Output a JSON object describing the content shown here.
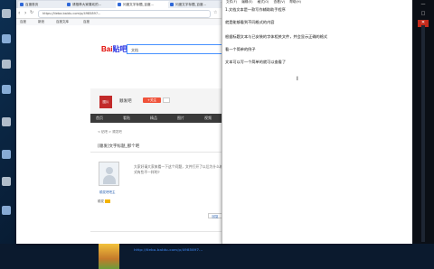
{
  "browser": {
    "tabs": [
      {
        "label": "百度首页",
        "active": false
      },
      {
        "label": "请推荐大家喜欢的...",
        "active": false
      },
      {
        "label": "问度文字标题_百度...",
        "active": true
      },
      {
        "label": "问度文字标题_百度...",
        "active": false
      }
    ],
    "new_tab": "+",
    "url": "https://tieba.baidu.com/p/4985897...",
    "bookmarks": [
      "百度",
      "新浪",
      "百度文库",
      "百度"
    ],
    "logo_text": "Bai",
    "logo_suffix": "贴吧",
    "search_value": "文档",
    "forum_icon_label": "图片",
    "forum_name": "顺发吧",
    "follow_label": "+关注",
    "forum_tabs": [
      "首页",
      "看贴",
      "精品",
      "图片",
      "视频"
    ],
    "breadcrumb": "< 贴吧 > 顺发吧",
    "thread_title": "[顺发]文字标题_那个吧",
    "user_name": "顺发吧吧主",
    "user_level": "顺发",
    "post_text": "大家好请大家来看一下这个问题，文件打开了以后为什么格式有些不一样的?",
    "reply_label": "回复",
    "link_text": "http://tieba.baidu.com/p/4985897..."
  },
  "notepad": {
    "menu": [
      "文件(F)",
      "编辑(E)",
      "格式(O)",
      "查看(V)",
      "帮助(H)"
    ],
    "lines": [
      "1.文档文本是一款写作辅助助手程序",
      "就是能够看到不同格式的内容",
      "根据标题文本与已安装的字体相关文件，并会显示正确的格式",
      "看一个简单的例子",
      "文本可以写一个简单的就可以查看了"
    ],
    "cursor": "I"
  },
  "window_controls": {
    "minimize": "—",
    "maximize": "□",
    "close": "✕"
  }
}
